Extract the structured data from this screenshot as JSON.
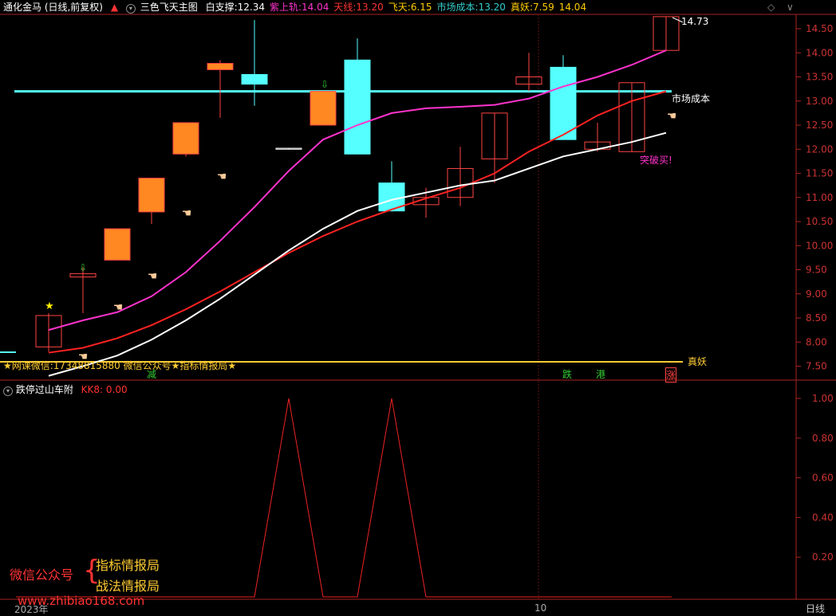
{
  "header": {
    "title": "通化金马 (日线,前复权)",
    "indicator": "三色飞天主图",
    "items": [
      {
        "label": "白支撑:",
        "value": "12.34",
        "color": "#ffffff"
      },
      {
        "label": "紫上轨:",
        "value": "14.04",
        "color": "#ff33cc"
      },
      {
        "label": "天线:",
        "value": "13.20",
        "color": "#ff3333"
      },
      {
        "label": "飞天:",
        "value": "6.15",
        "color": "#ffcc00"
      },
      {
        "label": "市场成本:",
        "value": "13.20",
        "color": "#33cccc"
      },
      {
        "label": "真妖:",
        "value": "7.59",
        "color": "#ffcc00"
      },
      {
        "label": "",
        "value": "14.04",
        "color": "#ffcc00"
      }
    ]
  },
  "main_annotations": {
    "high_label": "14.73",
    "market_cost_label": "市场成本",
    "breakout_label": "突破买!",
    "banner_text": "★网课微信:17348815880  微信公众号★指标情报局★",
    "zhenyao_label": "真妖",
    "bottom_marks": [
      {
        "text": "减",
        "color": "#33cc33"
      },
      {
        "text": "跌",
        "color": "#33cc33"
      },
      {
        "text": "港",
        "color": "#33cc33"
      },
      {
        "text": "涨",
        "color": "#ff4444"
      }
    ]
  },
  "sub_panel": {
    "title": "跌停过山车附",
    "series_label": "KK8: 0.00"
  },
  "footer": {
    "year_label": "2023年",
    "month_label": "10",
    "period_label": "日线"
  },
  "watermark": {
    "left": "微信公众号",
    "right_top": "指标情报局",
    "right_bottom": "战法情报局",
    "url": "www.zhibiao168.com"
  },
  "colors": {
    "up": "#ff4444",
    "up_fill": "#ff8822",
    "down": "#55ffff",
    "purple": "#ff33cc",
    "red": "#ff2222",
    "white": "#ffffff",
    "cyan": "#55ffff",
    "gold": "#ffcc33"
  },
  "chart_data": [
    {
      "type": "candlestick",
      "title": "通化金马 (日线,前复权)",
      "ylim": [
        7.3,
        14.85
      ],
      "yticks": [
        7.5,
        8.0,
        8.5,
        9.0,
        9.5,
        10.0,
        10.5,
        11.0,
        11.5,
        12.0,
        12.5,
        13.0,
        13.5,
        14.0,
        14.5
      ],
      "candles": [
        {
          "o": 7.9,
          "c": 8.55,
          "h": 8.6,
          "l": 7.8,
          "style": "hollow"
        },
        {
          "o": 9.35,
          "c": 9.42,
          "h": 9.55,
          "l": 8.6,
          "style": "hollow"
        },
        {
          "o": 9.7,
          "c": 10.35,
          "h": 10.35,
          "l": 9.7,
          "style": "fill"
        },
        {
          "o": 10.7,
          "c": 11.4,
          "h": 11.4,
          "l": 10.45,
          "style": "fill"
        },
        {
          "o": 11.9,
          "c": 12.55,
          "h": 12.55,
          "l": 11.85,
          "style": "fill"
        },
        {
          "o": 13.65,
          "c": 13.78,
          "h": 13.85,
          "l": 12.65,
          "style": "fill"
        },
        {
          "o": 13.55,
          "c": 13.35,
          "h": 14.68,
          "l": 12.9,
          "style": "down"
        },
        {
          "o": 12.0,
          "c": 12.02,
          "h": 12.02,
          "l": 12.0,
          "style": "doji"
        },
        {
          "o": 12.5,
          "c": 13.2,
          "h": 13.2,
          "l": 12.5,
          "style": "fill"
        },
        {
          "o": 13.85,
          "c": 11.9,
          "h": 14.3,
          "l": 11.9,
          "style": "down"
        },
        {
          "o": 11.3,
          "c": 10.72,
          "h": 11.75,
          "l": 10.72,
          "style": "down"
        },
        {
          "o": 10.85,
          "c": 11.0,
          "h": 11.2,
          "l": 10.58,
          "style": "hollow"
        },
        {
          "o": 11.0,
          "c": 11.6,
          "h": 12.05,
          "l": 10.82,
          "style": "hollow"
        },
        {
          "o": 11.8,
          "c": 12.75,
          "h": 12.75,
          "l": 11.3,
          "style": "hollow"
        },
        {
          "o": 13.35,
          "c": 13.5,
          "h": 14.0,
          "l": 13.2,
          "style": "hollow"
        },
        {
          "o": 13.7,
          "c": 12.2,
          "h": 13.95,
          "l": 12.2,
          "style": "down"
        },
        {
          "o": 12.0,
          "c": 12.15,
          "h": 12.55,
          "l": 11.95,
          "style": "hollow"
        },
        {
          "o": 11.95,
          "c": 13.38,
          "h": 13.38,
          "l": 11.95,
          "style": "hollow"
        },
        {
          "o": 14.05,
          "c": 14.75,
          "h": 14.75,
          "l": 14.05,
          "style": "hollow"
        }
      ],
      "series": [
        {
          "name": "紫上轨",
          "values": [
            8.25,
            8.45,
            8.62,
            8.95,
            9.45,
            10.1,
            10.8,
            11.55,
            12.2,
            12.5,
            12.75,
            12.85,
            12.88,
            12.92,
            13.05,
            13.3,
            13.5,
            13.75,
            14.05
          ]
        },
        {
          "name": "天线",
          "values": [
            7.78,
            7.88,
            8.08,
            8.35,
            8.68,
            9.05,
            9.45,
            9.85,
            10.2,
            10.5,
            10.75,
            10.98,
            11.2,
            11.5,
            11.95,
            12.3,
            12.7,
            13.0,
            13.2
          ]
        },
        {
          "name": "白支撑",
          "values": [
            7.3,
            7.5,
            7.72,
            8.05,
            8.45,
            8.9,
            9.4,
            9.9,
            10.35,
            10.72,
            10.95,
            11.1,
            11.25,
            11.35,
            11.6,
            11.85,
            12.0,
            12.15,
            12.34
          ]
        }
      ],
      "market_cost": 13.2,
      "zhenyao": 7.59
    },
    {
      "type": "line",
      "title": "跌停过山车附",
      "ylim": [
        0,
        1.08
      ],
      "yticks": [
        0.2,
        0.4,
        0.6,
        0.8,
        1.0
      ],
      "series": [
        {
          "name": "KK8",
          "values": [
            0,
            0,
            0,
            0,
            0,
            0,
            0,
            1,
            0,
            0,
            1,
            0,
            0,
            0,
            0,
            0,
            0,
            0,
            0
          ]
        }
      ]
    }
  ]
}
